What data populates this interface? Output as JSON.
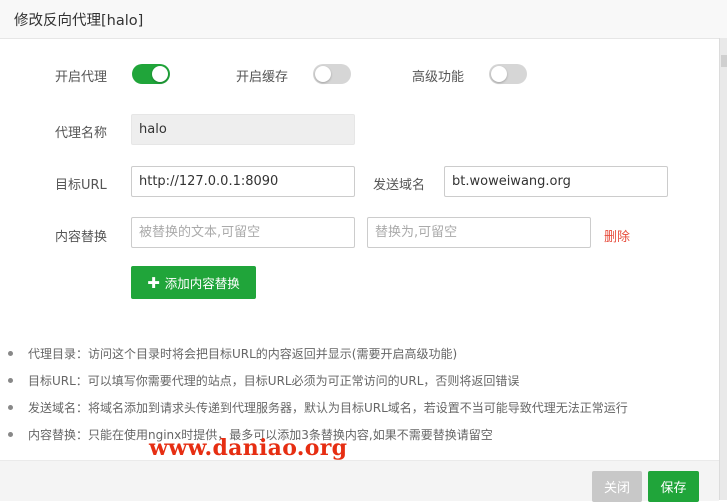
{
  "dialog": {
    "title": "修改反向代理[halo]"
  },
  "toggles": [
    {
      "label": "开启代理",
      "on": true
    },
    {
      "label": "开启缓存",
      "on": false
    },
    {
      "label": "高级功能",
      "on": false
    }
  ],
  "form": {
    "proxy_name_label": "代理名称",
    "proxy_name_value": "halo",
    "target_url_label": "目标URL",
    "target_url_value": "http://127.0.0.1:8090",
    "send_domain_label": "发送域名",
    "send_domain_value": "bt.woweiwang.org",
    "content_replace_label": "内容替换",
    "replace_from_placeholder": "被替换的文本,可留空",
    "replace_to_placeholder": "替换为,可留空",
    "delete_label": "删除",
    "add_replace_label": "添加内容替换"
  },
  "tips": [
    "代理目录：访问这个目录时将会把目标URL的内容返回并显示(需要开启高级功能)",
    "目标URL：可以填写你需要代理的站点，目标URL必须为可正常访问的URL，否则将返回错误",
    "发送域名：将域名添加到请求头传递到代理服务器，默认为目标URL域名，若设置不当可能导致代理无法正常运行",
    "内容替换：只能在使用nginx时提供，最多可以添加3条替换内容,如果不需要替换请留空"
  ],
  "watermark": "www.daniao.org",
  "footer": {
    "close_label": "关闭",
    "save_label": "保存"
  },
  "colors": {
    "accent": "#20a53a",
    "danger": "#e74c3c",
    "watermark": "#e62e12"
  }
}
